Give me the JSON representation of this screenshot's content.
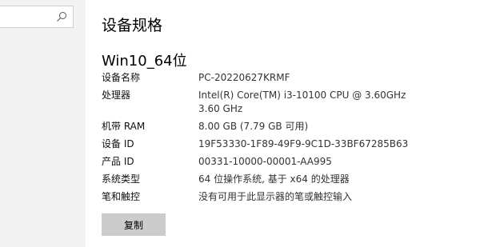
{
  "search": {
    "value": "",
    "placeholder": ""
  },
  "page_title": "设备规格",
  "device_name": "Win10_64位",
  "specs": [
    {
      "label": "设备名称",
      "value": "PC-20220627KRMF"
    },
    {
      "label": "处理器",
      "value": "Intel(R) Core(TM) i3-10100 CPU @ 3.60GHz   3.60 GHz"
    },
    {
      "label": "机带 RAM",
      "value": "8.00 GB (7.79 GB 可用)"
    },
    {
      "label": "设备 ID",
      "value": "19F53330-1F89-49F9-9C1D-33BF67285B63"
    },
    {
      "label": "产品 ID",
      "value": "00331-10000-00001-AA995"
    },
    {
      "label": "系统类型",
      "value": "64 位操作系统, 基于 x64 的处理器"
    },
    {
      "label": "笔和触控",
      "value": "没有可用于此显示器的笔或触控输入"
    }
  ],
  "copy_button_label": "复制",
  "colors": {
    "sidebar_bg": "#f2f2f2",
    "button_bg": "#cccccc"
  }
}
